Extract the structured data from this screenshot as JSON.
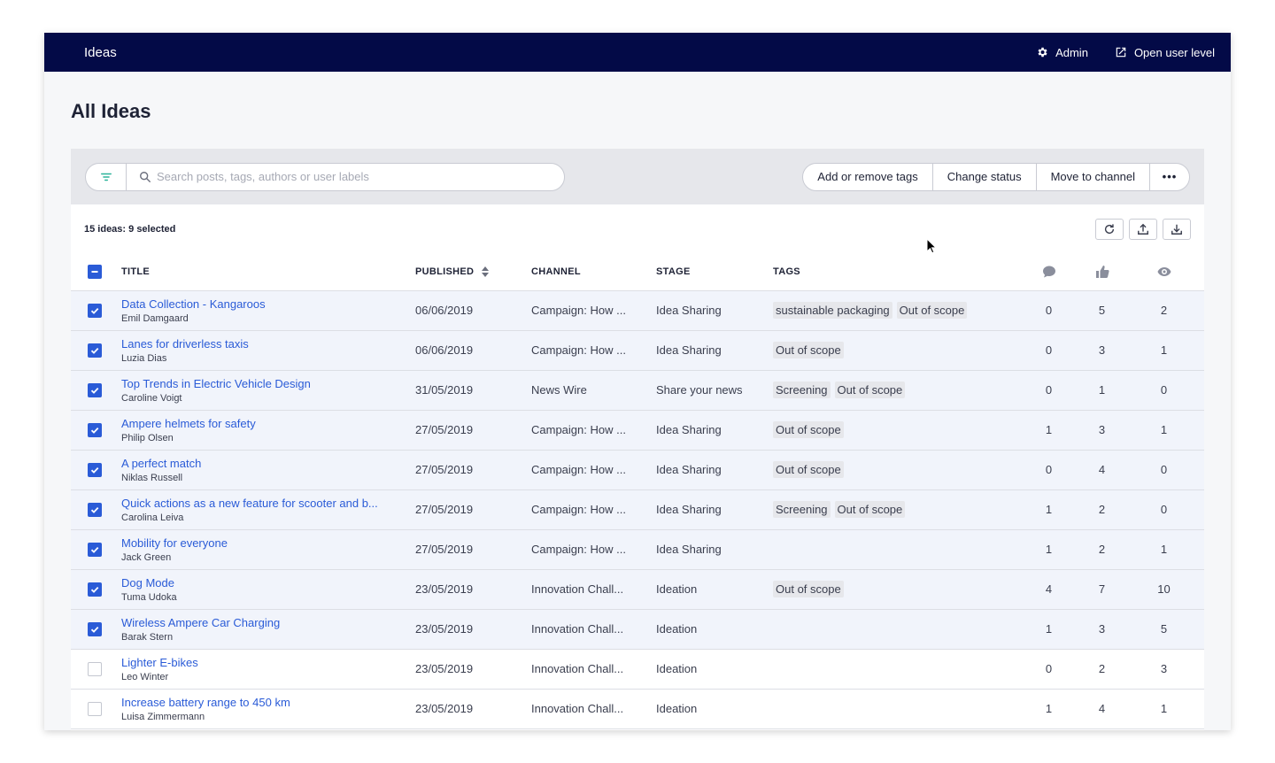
{
  "topbar": {
    "title": "Ideas",
    "admin_label": "Admin",
    "open_user_label": "Open user level"
  },
  "page": {
    "title": "All Ideas"
  },
  "search": {
    "placeholder": "Search posts, tags, authors or user labels",
    "value": ""
  },
  "actions": {
    "tags": "Add or remove tags",
    "status": "Change status",
    "move": "Move to channel",
    "more": "•••"
  },
  "summary": "15 ideas: 9 selected",
  "columns": {
    "title": "TITLE",
    "published": "PUBLISHED",
    "channel": "CHANNEL",
    "stage": "STAGE",
    "tags": "TAGS"
  },
  "icons": {
    "comments": "comment-icon",
    "likes": "thumbs-up-icon",
    "views": "eye-icon",
    "refresh": "refresh-icon",
    "upload": "upload-icon",
    "download": "download-icon",
    "filter": "filter-icon",
    "search": "search-icon",
    "admin": "gear-icon",
    "open_user": "external-link-icon"
  },
  "colors": {
    "topbar": "#030a47",
    "accent": "#2a5bd7",
    "tag_bg": "#e6e7eb"
  },
  "rows": [
    {
      "selected": true,
      "title": "Data Collection - Kangaroos",
      "author": "Emil Damgaard",
      "published": "06/06/2019",
      "channel": "Campaign: How ...",
      "stage": "Idea Sharing",
      "tags": [
        "sustainable packaging",
        "Out of scope"
      ],
      "comments": "0",
      "likes": "5",
      "views": "2"
    },
    {
      "selected": true,
      "title": "Lanes for driverless taxis",
      "author": "Luzia Dias",
      "published": "06/06/2019",
      "channel": "Campaign: How ...",
      "stage": "Idea Sharing",
      "tags": [
        "Out of scope"
      ],
      "comments": "0",
      "likes": "3",
      "views": "1"
    },
    {
      "selected": true,
      "title": "Top Trends in Electric Vehicle Design",
      "author": "Caroline Voigt",
      "published": "31/05/2019",
      "channel": "News Wire",
      "stage": "Share your news",
      "tags": [
        "Screening",
        "Out of scope"
      ],
      "comments": "0",
      "likes": "1",
      "views": "0"
    },
    {
      "selected": true,
      "title": "Ampere helmets for safety",
      "author": "Philip Olsen",
      "published": "27/05/2019",
      "channel": "Campaign: How ...",
      "stage": "Idea Sharing",
      "tags": [
        "Out of scope"
      ],
      "comments": "1",
      "likes": "3",
      "views": "1"
    },
    {
      "selected": true,
      "title": "A perfect match",
      "author": "Niklas Russell",
      "published": "27/05/2019",
      "channel": "Campaign: How ...",
      "stage": "Idea Sharing",
      "tags": [
        "Out of scope"
      ],
      "comments": "0",
      "likes": "4",
      "views": "0"
    },
    {
      "selected": true,
      "title": "Quick actions as a new feature for scooter and b...",
      "author": "Carolina Leiva",
      "published": "27/05/2019",
      "channel": "Campaign: How ...",
      "stage": "Idea Sharing",
      "tags": [
        "Screening",
        "Out of scope"
      ],
      "comments": "1",
      "likes": "2",
      "views": "0"
    },
    {
      "selected": true,
      "title": "Mobility for everyone",
      "author": "Jack Green",
      "published": "27/05/2019",
      "channel": "Campaign: How ...",
      "stage": "Idea Sharing",
      "tags": [],
      "comments": "1",
      "likes": "2",
      "views": "1"
    },
    {
      "selected": true,
      "title": "Dog Mode",
      "author": "Tuma Udoka",
      "published": "23/05/2019",
      "channel": "Innovation Chall...",
      "stage": "Ideation",
      "tags": [
        "Out of scope"
      ],
      "comments": "4",
      "likes": "7",
      "views": "10"
    },
    {
      "selected": true,
      "title": "Wireless Ampere Car Charging",
      "author": "Barak Stern",
      "published": "23/05/2019",
      "channel": "Innovation Chall...",
      "stage": "Ideation",
      "tags": [],
      "comments": "1",
      "likes": "3",
      "views": "5"
    },
    {
      "selected": false,
      "title": "Lighter E-bikes",
      "author": "Leo Winter",
      "published": "23/05/2019",
      "channel": "Innovation Chall...",
      "stage": "Ideation",
      "tags": [],
      "comments": "0",
      "likes": "2",
      "views": "3"
    },
    {
      "selected": false,
      "title": "Increase battery range to 450 km",
      "author": "Luisa Zimmermann",
      "published": "23/05/2019",
      "channel": "Innovation Chall...",
      "stage": "Ideation",
      "tags": [],
      "comments": "1",
      "likes": "4",
      "views": "1"
    }
  ]
}
